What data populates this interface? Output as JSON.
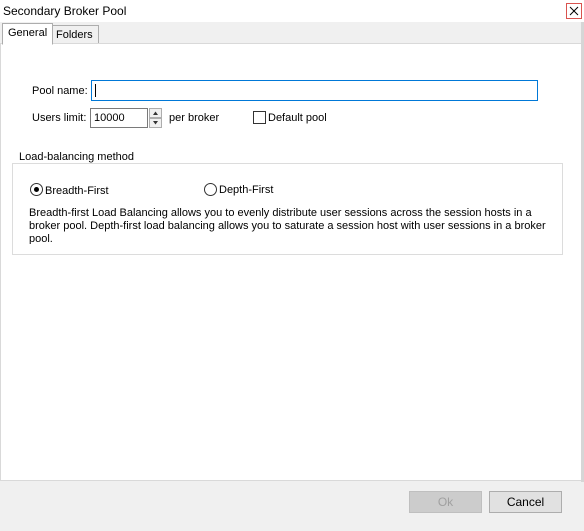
{
  "window": {
    "title": "Secondary Broker Pool"
  },
  "tabs": [
    {
      "label": "General",
      "active": true
    },
    {
      "label": "Folders",
      "active": false
    }
  ],
  "form": {
    "pool_name_label": "Pool name:",
    "pool_name_value": "",
    "users_limit_label": "Users limit:",
    "users_limit_value": "10000",
    "per_broker_label": "per broker",
    "default_pool_label": "Default pool",
    "default_pool_checked": false
  },
  "load_balancing": {
    "legend": "Load-balancing method",
    "options": [
      {
        "label": "Breadth-First",
        "selected": true
      },
      {
        "label": "Depth-First",
        "selected": false
      }
    ],
    "description": "Breadth-first Load Balancing allows you to evenly distribute user sessions across the session hosts in a broker pool. Depth-first load balancing allows you to saturate a session host with user sessions in a broker pool."
  },
  "buttons": {
    "ok_label": "Ok",
    "cancel_label": "Cancel"
  },
  "icons": {
    "close": "close-icon",
    "spin_up": "spin-up-icon",
    "spin_down": "spin-down-icon"
  },
  "colors": {
    "focus_border": "#0078d7",
    "close_border": "#d9534f"
  }
}
